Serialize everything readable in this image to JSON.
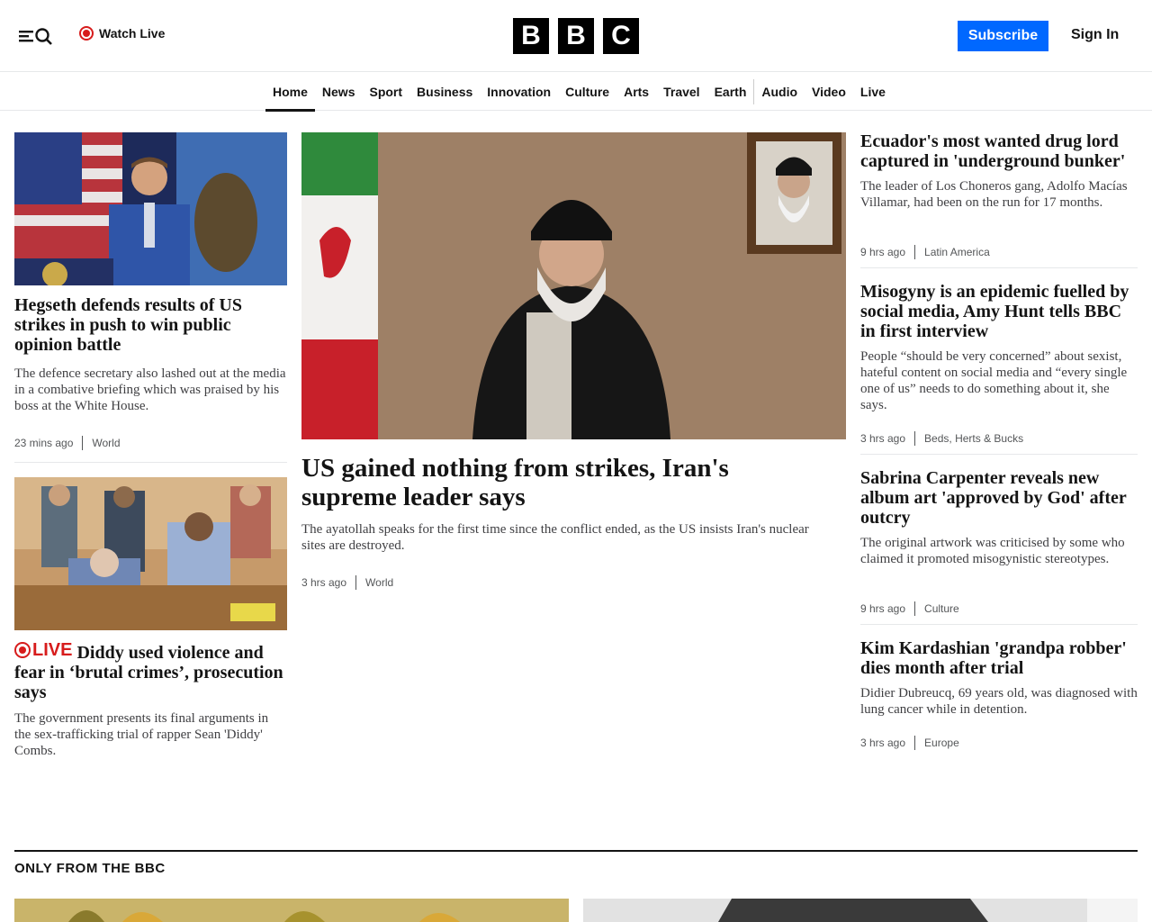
{
  "header": {
    "watch_live": "Watch Live",
    "logo_letters": [
      "B",
      "B",
      "C"
    ],
    "subscribe": "Subscribe",
    "sign_in": "Sign In"
  },
  "nav": {
    "items": [
      "Home",
      "News",
      "Sport",
      "Business",
      "Innovation",
      "Culture",
      "Arts",
      "Travel",
      "Earth",
      "Audio",
      "Video",
      "Live"
    ],
    "active": "Home"
  },
  "left": {
    "story1": {
      "headline": "Hegseth defends results of US strikes in push to win public opinion battle",
      "summary": "The defence secretary also lashed out at the media in a combative briefing which was praised by his boss at the White House.",
      "time": "23 mins ago",
      "section": "World"
    },
    "story2": {
      "live_label": "LIVE",
      "headline": "Diddy used violence and fear in ‘brutal crimes’, prosecution says",
      "summary": "The government presents its final arguments in the sex-trafficking trial of rapper Sean 'Diddy' Combs."
    }
  },
  "main": {
    "headline": "US gained nothing from strikes, Iran's supreme leader says",
    "summary": "The ayatollah speaks for the first time since the conflict ended, as the US insists Iran's nuclear sites are destroyed.",
    "time": "3 hrs ago",
    "section": "World"
  },
  "right": [
    {
      "headline": "Ecuador's most wanted drug lord captured in 'underground bunker'",
      "summary": "The leader of Los Choneros gang, Adolfo Macías Villamar, had been on the run for 17 months.",
      "time": "9 hrs ago",
      "section": "Latin America"
    },
    {
      "headline": "Misogyny is an epidemic fuelled by social media, Amy Hunt tells BBC in first interview",
      "summary": "People “should be very concerned” about sexist, hateful content on social media and “every single one of us” needs to do something about it, she says.",
      "time": "3 hrs ago",
      "section": "Beds, Herts & Bucks"
    },
    {
      "headline": "Sabrina Carpenter reveals new album art 'approved by God' after outcry",
      "summary": "The original artwork was criticised by some who claimed it promoted misogynistic stereotypes.",
      "time": "9 hrs ago",
      "section": "Culture"
    },
    {
      "headline": "Kim Kardashian 'grandpa robber' dies month after trial",
      "summary": "Didier Dubreucq, 69 years old, was diagnosed with lung cancer while in detention.",
      "time": "3 hrs ago",
      "section": "Europe"
    }
  ],
  "only_bbc": {
    "title": "ONLY FROM THE BBC"
  }
}
